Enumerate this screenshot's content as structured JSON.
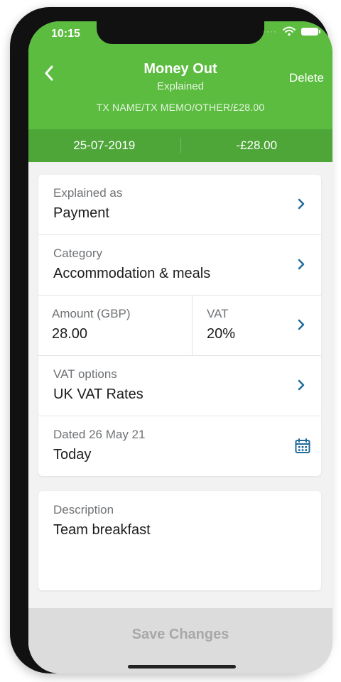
{
  "status_bar": {
    "time": "10:15",
    "dots": "····"
  },
  "header": {
    "title": "Money Out",
    "subtitle": "Explained",
    "memo": "TX NAME/TX MEMO/OTHER/£28.00",
    "delete_label": "Delete",
    "back_icon": "chevron-left-icon",
    "color": "#5bbc3f"
  },
  "summary": {
    "date": "25-07-2019",
    "amount": "-£28.00",
    "color": "#4ea639"
  },
  "fields": {
    "explained_as": {
      "label": "Explained as",
      "value": "Payment"
    },
    "category": {
      "label": "Category",
      "value": "Accommodation & meals"
    },
    "amount": {
      "label": "Amount (GBP)",
      "value": "28.00"
    },
    "vat": {
      "label": "VAT",
      "value": "20%"
    },
    "vat_options": {
      "label": "VAT options",
      "value": "UK VAT Rates"
    },
    "dated": {
      "label": "Dated 26 May 21",
      "value": "Today"
    },
    "description": {
      "label": "Description",
      "value": "Team breakfast"
    }
  },
  "save_button": {
    "label": "Save Changes"
  },
  "accent_color": "#1f6b9a"
}
